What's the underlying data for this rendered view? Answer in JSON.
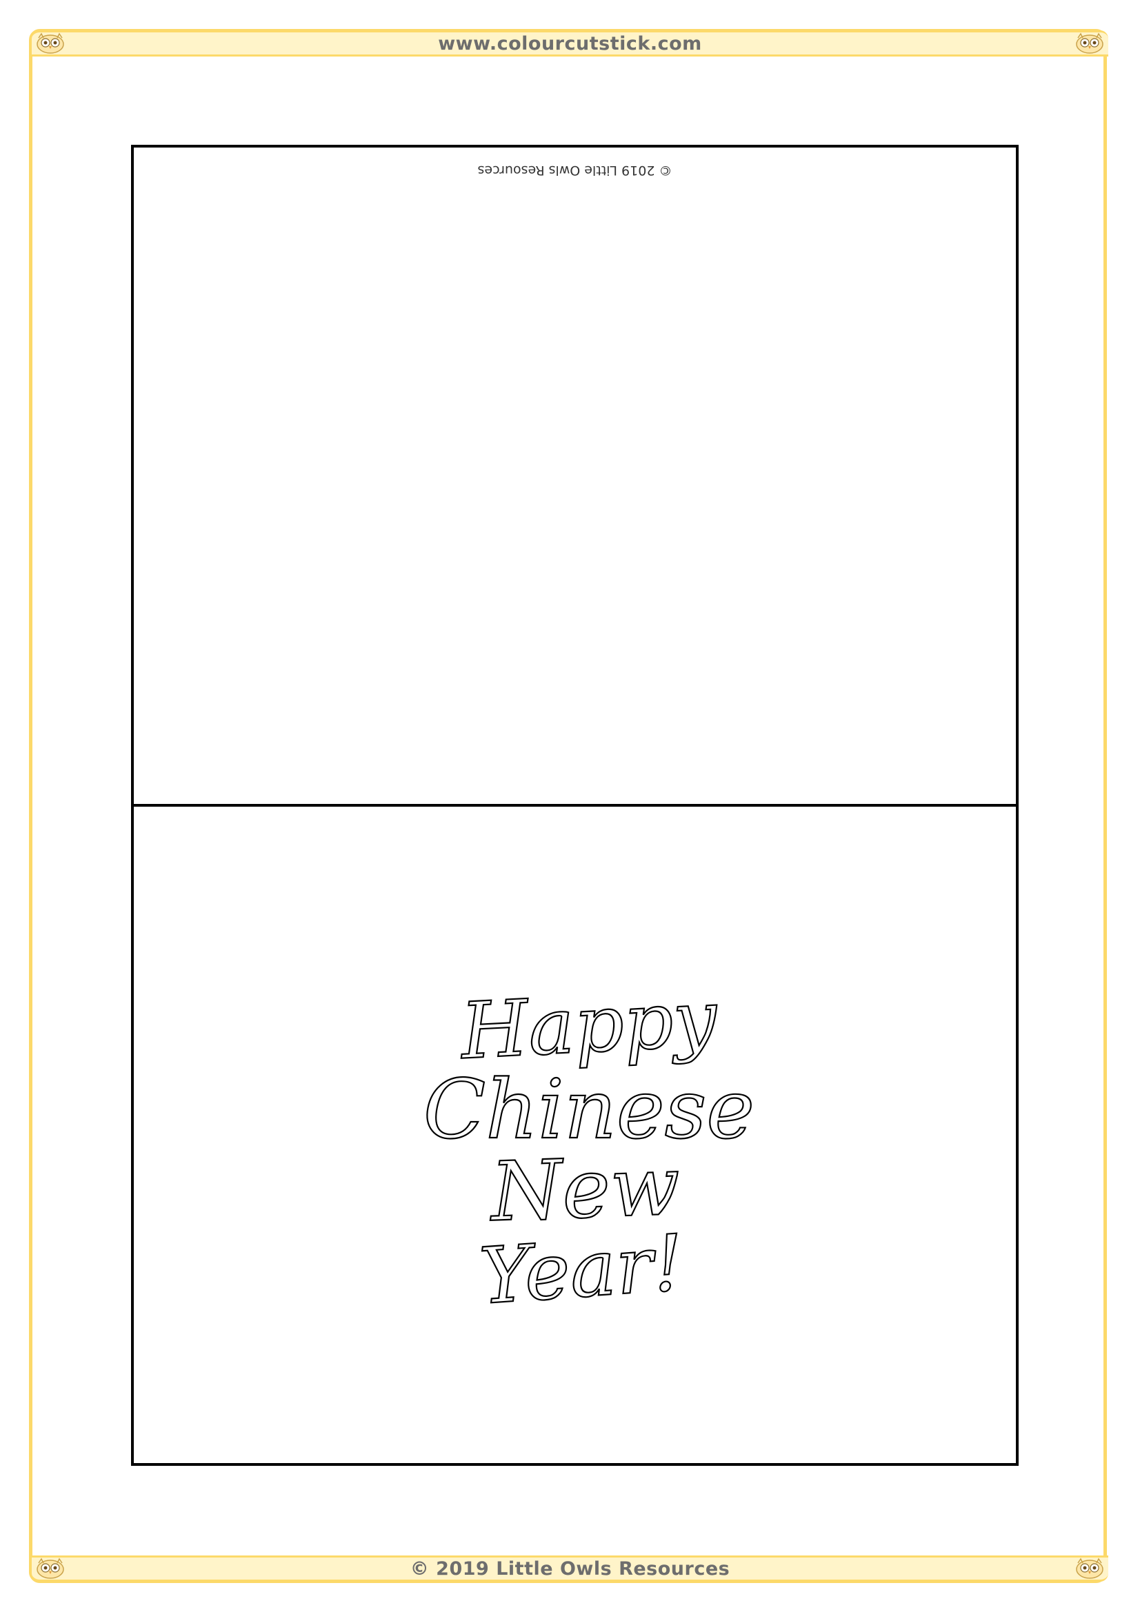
{
  "header": {
    "website": "www.colourcutstick.com"
  },
  "footer": {
    "copyright": "© 2019 Little Owls Resources"
  },
  "card": {
    "inside_panel": {
      "copyright_upside_down": "© 2019 Little Owls Resources"
    },
    "front_panel": {
      "greeting_lines": [
        "Happy",
        "Chinese",
        "New",
        "Year!"
      ]
    }
  },
  "colors": {
    "border": "#fcd96a",
    "band_fill": "#fff4c9",
    "band_text": "#6d6d6d",
    "outline": "#000000"
  },
  "icons": {
    "corner_decoration": "owl-icon"
  }
}
